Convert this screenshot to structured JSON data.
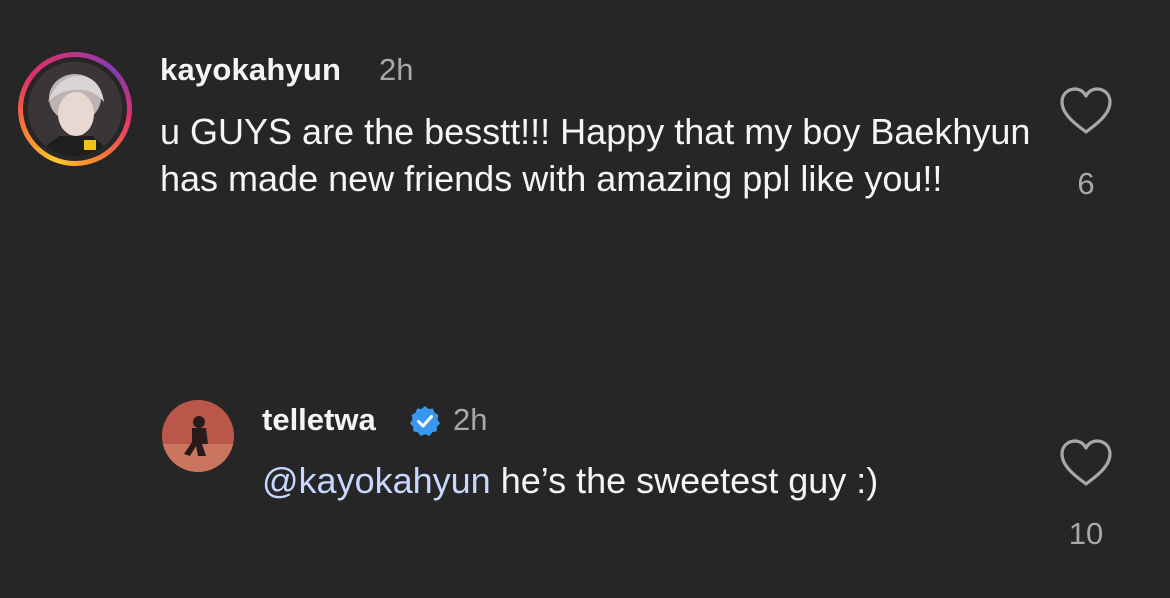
{
  "comments": [
    {
      "username": "kayokahyun",
      "time": "2h",
      "text": "u GUYS are the besstt!!! Happy that my boy Baekhyun has made new friends with amazing ppl like you!!",
      "likes": "6",
      "avatar_ring": true,
      "like_icon": "heart-outline-icon"
    },
    {
      "username": "telletwa",
      "verified": true,
      "verified_icon": "verified-badge-icon",
      "time": "2h",
      "mention": "@kayokahyun",
      "text": " he’s the sweetest guy :)",
      "likes": "10",
      "like_icon": "heart-outline-icon"
    }
  ],
  "colors": {
    "background": "#262626",
    "primary_text": "#f5f5f5",
    "secondary_text": "#a8a8a8",
    "mention": "#c7d7ff",
    "verified": "#3897f0"
  }
}
